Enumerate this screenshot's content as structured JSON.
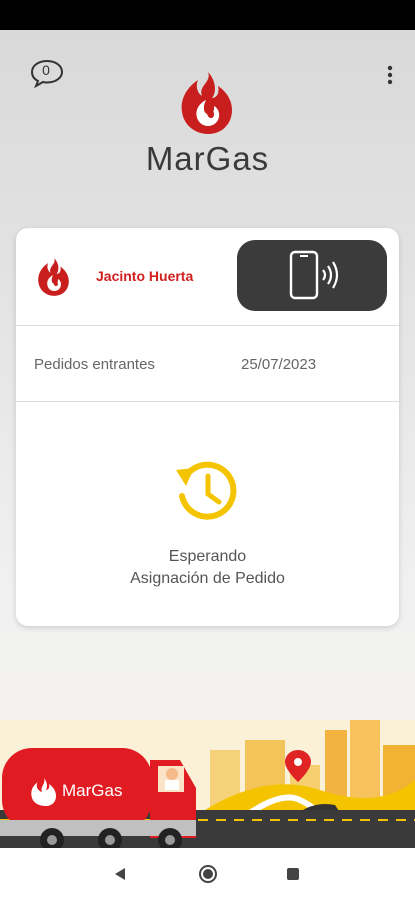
{
  "header": {
    "notification_count": "0",
    "brand_name": "MarGas",
    "icons": {
      "chat": "chat-bubble-icon",
      "menu": "kebab-menu-icon"
    }
  },
  "card": {
    "driver_name": "Jacinto Huerta",
    "orders_label": "Pedidos entrantes",
    "orders_date": "25/07/2023",
    "status_line1": "Esperando",
    "status_line2": "Asignación de Pedido",
    "icons": {
      "nfc": "phone-nfc-icon",
      "status": "clock-restore-icon"
    }
  },
  "illustration": {
    "truck_brand": "MarGas"
  },
  "colors": {
    "brand_red": "#d21f1f",
    "accent_yellow": "#f5c400",
    "dark_button": "#3b3b3b"
  }
}
